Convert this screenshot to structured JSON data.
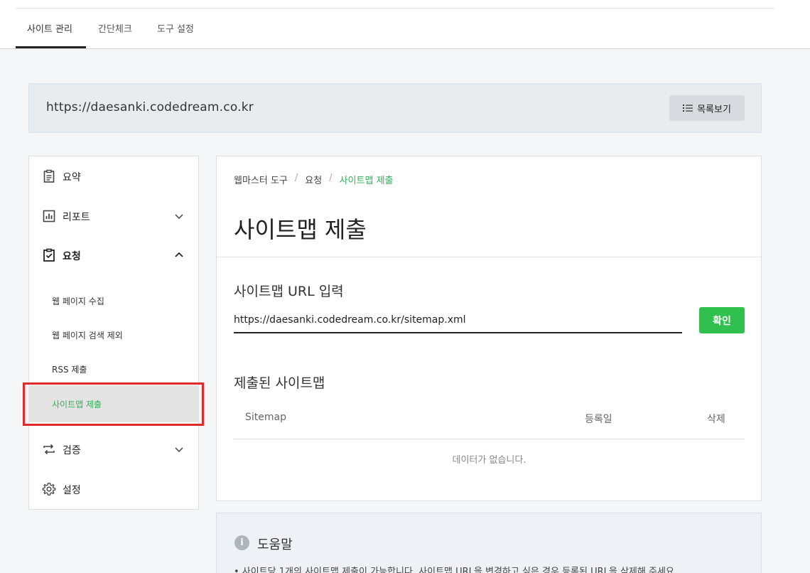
{
  "tabs": [
    {
      "label": "사이트 관리",
      "active": true
    },
    {
      "label": "간단체크",
      "active": false
    },
    {
      "label": "도구 설정",
      "active": false
    }
  ],
  "site": {
    "url": "https://daesanki.codedream.co.kr",
    "list_button": "목록보기"
  },
  "sidebar": {
    "items": [
      {
        "label": "요약",
        "icon": "clipboard-icon"
      },
      {
        "label": "리포트",
        "icon": "bar-chart-icon",
        "expanded": false
      },
      {
        "label": "요청",
        "icon": "clipboard-check-icon",
        "expanded": true
      },
      {
        "label": "검증",
        "icon": "repeat-icon",
        "expanded": false
      },
      {
        "label": "설정",
        "icon": "gear-icon"
      }
    ],
    "sub_items": [
      {
        "label": "웹 페이지 수집"
      },
      {
        "label": "웹 페이지 검색 제외"
      },
      {
        "label": "RSS 제출"
      },
      {
        "label": "사이트맵 제출",
        "active": true
      }
    ]
  },
  "breadcrumb": [
    "웹마스터 도구",
    "요청",
    "사이트맵 제출"
  ],
  "page_title": "사이트맵 제출",
  "sitemap_input": {
    "title": "사이트맵 URL 입력",
    "value": "https://daesanki.codedream.co.kr/sitemap.xml",
    "button": "확인"
  },
  "submitted": {
    "title": "제출된 사이트맵",
    "columns": [
      "Sitemap",
      "등록일",
      "삭제"
    ],
    "empty_text": "데이터가 없습니다."
  },
  "help": {
    "title": "도움말",
    "text": "• 사이트당 1개의 사이트맵 제출이 가능합니다. 사이트맵 URL을 변경하고 싶은 경우 등록된 URL을 삭제해 주세요."
  },
  "colors": {
    "accent": "#2db256",
    "confirm": "#2fc04d",
    "highlight": "#e02a2a"
  }
}
